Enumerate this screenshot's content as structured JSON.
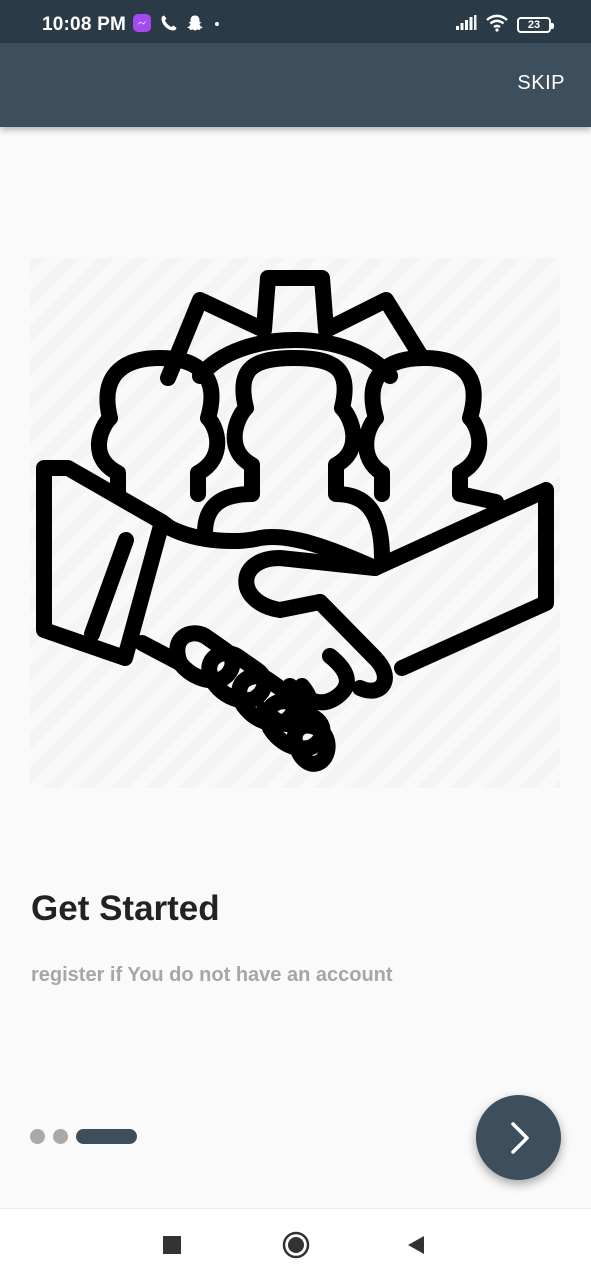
{
  "status_bar": {
    "time": "10:08 PM",
    "battery": "23",
    "notification_icons": [
      "messenger-icon",
      "phone-icon",
      "snapchat-icon",
      "dot-icon"
    ],
    "system_icons": [
      "signal-icon",
      "wifi-icon",
      "battery-icon"
    ]
  },
  "app_bar": {
    "skip_label": "SKIP"
  },
  "onboarding": {
    "illustration": "handshake-team-gear-icon",
    "title": "Get Started",
    "subtitle": "register if You do not have an account",
    "page_count": 3,
    "active_page": 3
  },
  "next_button": {
    "icon": "chevron-right-icon"
  },
  "nav_bar": {
    "buttons": [
      "recents-square-icon",
      "home-circle-icon",
      "back-triangle-icon"
    ]
  },
  "colors": {
    "status_bar": "#2b3a47",
    "app_bar": "#3d4e5c",
    "accent": "#3d4e5c",
    "background": "#fafafa",
    "title": "#222222",
    "subtitle": "#a6a6a6",
    "inactive_dot": "#a9a9a9"
  }
}
